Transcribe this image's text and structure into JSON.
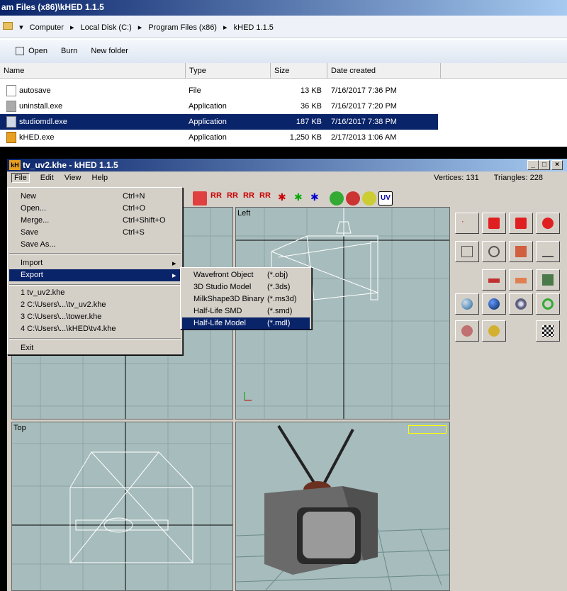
{
  "explorer": {
    "title": "am Files (x86)\\kHED 1.1.5",
    "breadcrumb": [
      "Computer",
      "Local Disk (C:)",
      "Program Files (x86)",
      "kHED 1.1.5"
    ],
    "toolbar": [
      "Open",
      "Burn",
      "New folder"
    ],
    "columns": [
      "Name",
      "Type",
      "Size",
      "Date created"
    ],
    "files": [
      {
        "name": "autosave",
        "type": "File",
        "size": "13 KB",
        "date": "7/16/2017 7:36 PM"
      },
      {
        "name": "uninstall.exe",
        "type": "Application",
        "size": "36 KB",
        "date": "7/16/2017 7:20 PM"
      },
      {
        "name": "studiomdl.exe",
        "type": "Application",
        "size": "187 KB",
        "date": "7/16/2017 7:38 PM"
      },
      {
        "name": "kHED.exe",
        "type": "Application",
        "size": "1,250 KB",
        "date": "2/17/2013 1:06 AM"
      }
    ]
  },
  "khed": {
    "title": "tv_uv2.khe - kHED 1.1.5",
    "logo": "kH",
    "menu": [
      "File",
      "Edit",
      "View",
      "Help"
    ],
    "vertices": "Vertices: 131",
    "triangles": "Triangles: 228",
    "uv_button": "UV",
    "viewports": {
      "left": "Left",
      "top": "Top"
    }
  },
  "file_menu": {
    "items": [
      {
        "label": "New",
        "shortcut": "Ctrl+N"
      },
      {
        "label": "Open...",
        "shortcut": "Ctrl+O"
      },
      {
        "label": "Merge...",
        "shortcut": "Ctrl+Shift+O"
      },
      {
        "label": "Save",
        "shortcut": "Ctrl+S"
      },
      {
        "label": "Save As...",
        "shortcut": ""
      }
    ],
    "import": "Import",
    "export": "Export",
    "recent": [
      "1 tv_uv2.khe",
      "2 C:\\Users\\...\\tv_uv2.khe",
      "3 C:\\Users\\...\\tower.khe",
      "4 C:\\Users\\...\\kHED\\tv4.khe"
    ],
    "exit": "Exit"
  },
  "export_menu": [
    {
      "label": "Wavefront Object",
      "ext": "(*.obj)"
    },
    {
      "label": "3D Studio Model",
      "ext": "(*.3ds)"
    },
    {
      "label": "MilkShape3D Binary",
      "ext": "(*.ms3d)"
    },
    {
      "label": "Half-Life SMD",
      "ext": "(*.smd)"
    },
    {
      "label": "Half-Life Model",
      "ext": "(*.mdl)"
    }
  ]
}
